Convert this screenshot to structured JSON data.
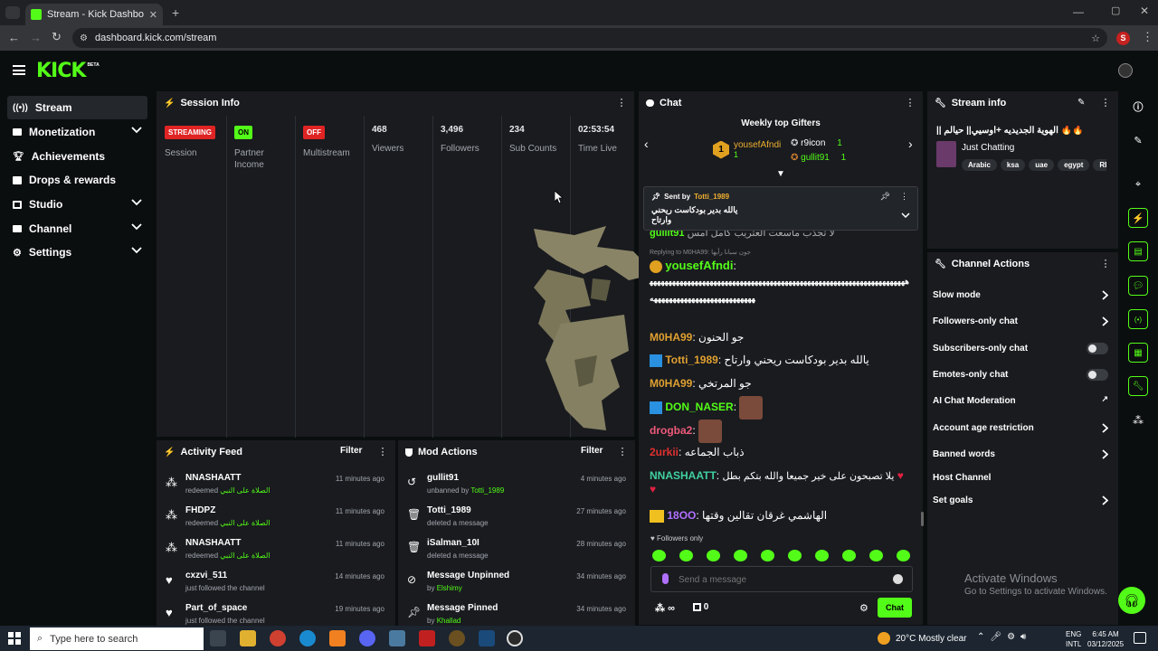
{
  "browser": {
    "tab_title": "Stream - Kick Dashboard",
    "url": "dashboard.kick.com/stream",
    "profile_initial": "S"
  },
  "brand": {
    "logo": "KICK",
    "beta": "BETA",
    "accent": "#53fc18"
  },
  "sidebar": {
    "items": [
      {
        "label": "Stream",
        "icon": "broadcast-icon",
        "active": true
      },
      {
        "label": "Monetization",
        "icon": "money-icon"
      },
      {
        "label": "Achievements",
        "icon": "trophy-icon"
      },
      {
        "label": "Drops & rewards",
        "icon": "gift-icon"
      },
      {
        "label": "Studio",
        "icon": "studio-icon"
      },
      {
        "label": "Channel",
        "icon": "channel-icon"
      },
      {
        "label": "Settings",
        "icon": "gear-icon"
      }
    ]
  },
  "session": {
    "title": "Session Info",
    "stats": [
      {
        "value": "STREAMING",
        "label": "Session"
      },
      {
        "value": "ON",
        "label": "Partner Income"
      },
      {
        "value": "OFF",
        "label": "Multistream"
      },
      {
        "value": "468",
        "label": "Viewers"
      },
      {
        "value": "3,496",
        "label": "Followers"
      },
      {
        "value": "234",
        "label": "Sub Counts"
      },
      {
        "value": "02:53:54",
        "label": "Time Live"
      }
    ]
  },
  "activity": {
    "title": "Activity Feed",
    "filter": "Filter",
    "items": [
      {
        "name": "NNASHAATT",
        "action": "redeemed",
        "reward": "الصلاة على النبي",
        "time": "11 minutes ago"
      },
      {
        "name": "FHDPZ",
        "action": "redeemed",
        "reward": "الصلاة على النبي",
        "time": "11 minutes ago"
      },
      {
        "name": "NNASHAATT",
        "action": "redeemed",
        "reward": "الصلاة على النبي",
        "time": "11 minutes ago"
      },
      {
        "name": "cxzvi_511",
        "action": "just followed the channel",
        "reward": "",
        "time": "14 minutes ago"
      },
      {
        "name": "Part_of_space",
        "action": "just followed the channel",
        "reward": "",
        "time": "19 minutes ago"
      }
    ]
  },
  "mod_actions": {
    "title": "Mod Actions",
    "filter": "Filter",
    "items": [
      {
        "name": "gullit91",
        "action": "unbanned by",
        "by": "Totti_1989",
        "time": "4 minutes ago"
      },
      {
        "name": "Totti_1989",
        "action": "deleted a message",
        "by": "",
        "time": "27 minutes ago"
      },
      {
        "name": "iSalman_10I",
        "action": "deleted a message",
        "by": "",
        "time": "28 minutes ago"
      },
      {
        "name": "Message Unpinned",
        "action": "by",
        "by": "Elshimy",
        "time": "34 minutes ago"
      },
      {
        "name": "Message Pinned",
        "action": "by",
        "by": "Khallad",
        "time": "34 minutes ago"
      }
    ]
  },
  "chat": {
    "title": "Chat",
    "gifters_title": "Weekly top Gifters",
    "gifters": [
      {
        "rank": "1",
        "name": "yousefAfndi",
        "count": "1"
      },
      {
        "rank": "2",
        "name": "r9icon",
        "count": "1"
      },
      {
        "rank": "3",
        "name": "gullit91",
        "count": "1"
      }
    ],
    "pinned": {
      "sent_by_label": "Sent by",
      "user": "Totti_1989",
      "text": "يالله بدير بودكاست ريحني وارتاح"
    },
    "partial_top": {
      "user": "gullit91",
      "text": "لا تجذب ماسعت العتريب كامل امس"
    },
    "reply": {
      "label": "Replying to M0HA99:",
      "text": "جون سبانا رأيها"
    },
    "messages": [
      {
        "user": "yousefAfndi",
        "color": "#53fc18",
        "text": "ههههههههههههههههههههههههههههههههههههههههههههههههههههههههههههههههههههههههههههههههههههههههههههههههه"
      },
      {
        "user": "M0HA99",
        "color": "#e0a030",
        "text": "جو الحنون"
      },
      {
        "user": "Totti_1989",
        "color": "#e0a030",
        "text": "يالله بدير بودكاست ريحني وارتاح"
      },
      {
        "user": "M0HA99",
        "color": "#e0a030",
        "text": "جو المرتخي"
      },
      {
        "user": "DON_NASER",
        "color": "#53fc18",
        "text": ""
      },
      {
        "user": "drogba2",
        "color": "#f05a7a",
        "text": ""
      },
      {
        "user": "2urkii",
        "color": "#e03030",
        "text": "ذباب الجماعه"
      },
      {
        "user": "NNASHAATT",
        "color": "#40d0a0",
        "text": "يلا تصبحون على خير جميعا والله بتكم بطل"
      },
      {
        "user": "18OO",
        "color": "#b070ff",
        "text": "الهاشمي غرقان تقالين وقتها"
      }
    ],
    "followers_only": "Followers only",
    "placeholder": "Send a message",
    "infinity_count": "∞",
    "gift_count": "0",
    "send_label": "Chat"
  },
  "stream_info": {
    "title": "Stream info",
    "stream_title": "|| الهوية الجديديه +اوسيي|| حيالم 🔥🔥",
    "category": "Just Chatting",
    "tags": [
      "Arabic",
      "ksa",
      "uae",
      "egypt",
      "RESI"
    ]
  },
  "channel_actions": {
    "title": "Channel Actions",
    "items": [
      {
        "label": "Slow mode",
        "control": "arrow"
      },
      {
        "label": "Followers-only chat",
        "control": "arrow"
      },
      {
        "label": "Subscribers-only chat",
        "control": "toggle"
      },
      {
        "label": "Emotes-only chat",
        "control": "toggle"
      },
      {
        "label": "AI Chat Moderation",
        "control": "external"
      },
      {
        "label": "Account age restriction",
        "control": "arrow"
      },
      {
        "label": "Banned words",
        "control": "arrow"
      },
      {
        "label": "Host Channel",
        "control": "none"
      },
      {
        "label": "Set goals",
        "control": "arrow"
      }
    ]
  },
  "watermark": {
    "title": "Activate Windows",
    "subtitle": "Go to Settings to activate Windows."
  },
  "taskbar": {
    "search_placeholder": "Type here to search",
    "weather": "20°C  Mostly clear",
    "lang": "ENG",
    "region": "INTL",
    "time": "6:45 AM",
    "date": "03/12/2025"
  }
}
